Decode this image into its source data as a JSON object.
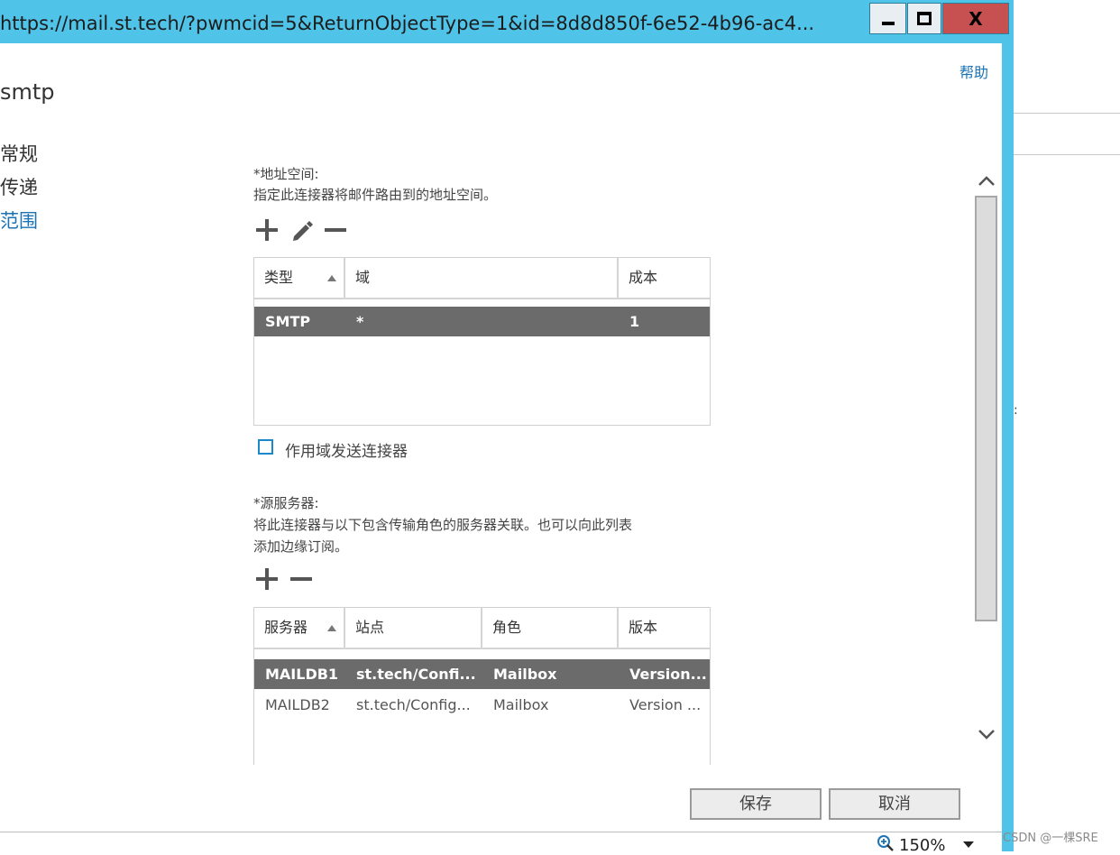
{
  "window": {
    "url": "https://mail.st.tech/?pwmcid=5&ReturnObjectType=1&id=8d8d850f-6e52-4b96-ac4...",
    "minimize_label": "–",
    "close_label": "X"
  },
  "header": {
    "help": "帮助",
    "title": "smtp"
  },
  "nav": {
    "items": [
      "常规",
      "传递",
      "范围"
    ],
    "active": "范围"
  },
  "address_space": {
    "label": "*地址空间:",
    "description": "指定此连接器将邮件路由到的地址空间。",
    "columns": [
      "类型",
      "域",
      "成本"
    ],
    "rows": [
      {
        "type": "SMTP",
        "domain": "*",
        "cost": "1",
        "selected": true
      }
    ]
  },
  "scoped": {
    "label": "作用域发送连接器",
    "checked": false
  },
  "source_servers": {
    "label": "*源服务器:",
    "description_line1": "将此连接器与以下包含传输角色的服务器关联。也可以向此列表",
    "description_line2": "添加边缘订阅。",
    "columns": [
      "服务器",
      "站点",
      "角色",
      "版本"
    ],
    "rows": [
      {
        "server": "MAILDB1",
        "site": "st.tech/Confi...",
        "role": "Mailbox",
        "version": "Version...",
        "selected": true
      },
      {
        "server": "MAILDB2",
        "site": "st.tech/Config...",
        "role": "Mailbox",
        "version": "Version ...",
        "selected": false
      }
    ]
  },
  "buttons": {
    "save": "保存",
    "cancel": "取消"
  },
  "status": {
    "zoom": "150%"
  },
  "watermark": "CSDN @一棵SRE",
  "colors": {
    "titlebar": "#4fc3e8",
    "link": "#1a73b5",
    "selected_row": "#6b6b6b",
    "close_button": "#c75050"
  }
}
